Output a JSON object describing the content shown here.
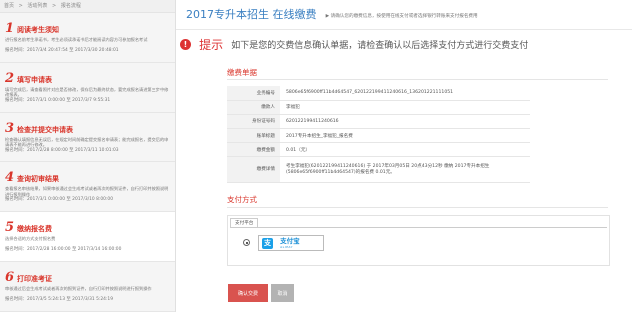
{
  "breadcrumb": [
    "首页",
    "活动列表",
    "报名流程"
  ],
  "steps": [
    {
      "num": "1",
      "title": "阅读考生须知",
      "desc": "进行报名前考生承诺书，考生必须读承诺书后才能阅读内容方可参加报名考试",
      "time": "报名时间：2017/3/4 20:47:54 至 2017/3/30 20:48:01"
    },
    {
      "num": "2",
      "title": "填写申请表",
      "desc": "填写完成后，请查看照片对应是否修改，保存后为最终状态，要完成报名请进第三步中修改报表。",
      "time": "报名时间：2017/3/1 0:00:00 至 2017/3/7 9:55:31"
    },
    {
      "num": "3",
      "title": "检查并提交申请表",
      "desc": "检查确认填报信息无误后，在规定时间前确定提交报名申请表；能完成报名，提交后的申请表不能再进行修改。",
      "time": "报名时间：2017/2/28 8:00:00 至 2017/3/11 10:01:03"
    },
    {
      "num": "4",
      "title": "查询初审结果",
      "desc": "查看报名审核结果，如果审核通过会生成考试或者再次的报到证件，自行打印并按照说明进行报到操作",
      "time": "报名时间：2017/3/1 0:00:00 至 2017/3/10 8:00:00"
    },
    {
      "num": "5",
      "title": "缴纳报名费",
      "desc": "选择合适的方式支付报名费",
      "time": "报名时间：2017/2/28 16:00:00 至 2017/3/14 16:00:00"
    },
    {
      "num": "6",
      "title": "打印准考证",
      "desc": "审核通过后会生成考试或者再次的报到证件，自行打印并按照说明进行报到操作",
      "time": "报名时间：2017/3/5 5:24:13 至 2017/3/31 5:24:19"
    }
  ],
  "header": {
    "title": "2017专升本招生 在线缴费",
    "notice": "请确认您的缴费信息，按使用在线支付或者选择银行转账来支付报名费用"
  },
  "tip": {
    "icon_char": "!",
    "label": "提示",
    "text": "如下是您的交费信息确认单据，请检查确认以后选择支付方式进行交费支付"
  },
  "bill": {
    "title": "缴费单据",
    "rows": [
      {
        "key": "业务编号",
        "value": "5806e65f6900ff11b4d64547_620122199411240616_136201221111051"
      },
      {
        "key": "缴款人",
        "value": "李福犯"
      },
      {
        "key": "身份证号码",
        "value": "620122199411240616"
      },
      {
        "key": "账单标题",
        "value": "2017专升本招生_李福犯_报名费"
      },
      {
        "key": "缴费金额",
        "value": "0.01（元）"
      },
      {
        "key": "缴费详情",
        "value": "考生李福犯(620122199411240616) 于 2017年03月05日 20点43分12秒 缴纳 2017专升本招生(5806e65f6900ff11b4d64547)的报名费 0.01元。"
      }
    ]
  },
  "payment": {
    "title": "支付方式",
    "tab": "支付平台",
    "alipay_glyph": "支",
    "alipay_cn": "支付宝",
    "alipay_en": "ALIPAY"
  },
  "buttons": {
    "confirm": "确认交费",
    "cancel": "取消"
  }
}
